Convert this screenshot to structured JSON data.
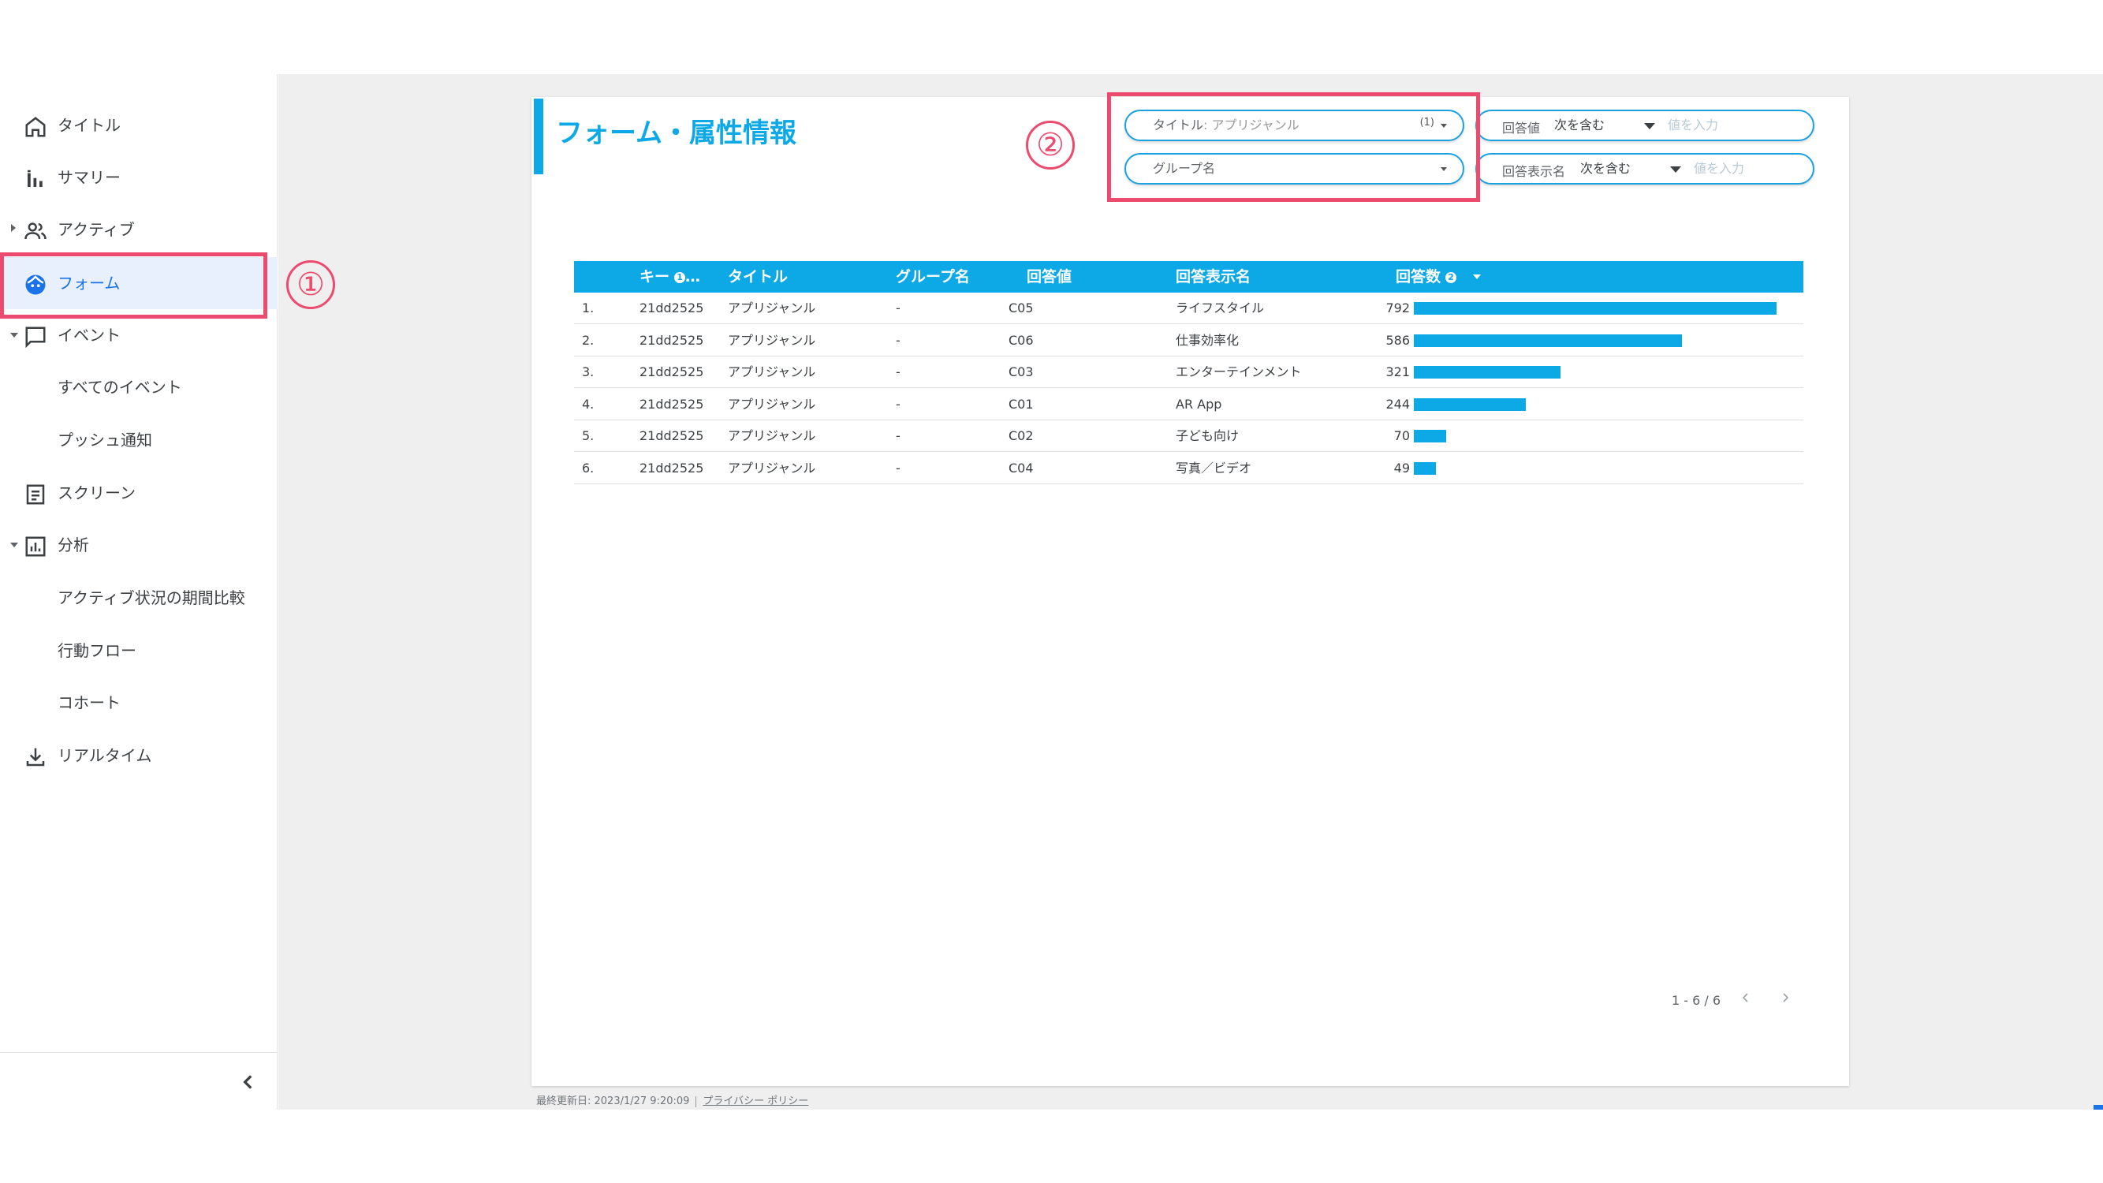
{
  "sidebar": {
    "items": [
      {
        "label": "タイトル",
        "icon": "home-icon"
      },
      {
        "label": "サマリー",
        "icon": "bar-chart-icon"
      },
      {
        "label": "アクティブ",
        "icon": "people-icon"
      },
      {
        "label": "フォーム",
        "icon": "face-icon"
      },
      {
        "label": "イベント",
        "icon": "comment-icon"
      },
      {
        "label": "すべてのイベント"
      },
      {
        "label": "プッシュ通知"
      },
      {
        "label": "スクリーン",
        "icon": "document-icon"
      },
      {
        "label": "分析",
        "icon": "analytics-icon"
      },
      {
        "label": "アクティブ状況の期間比較"
      },
      {
        "label": "行動フロー"
      },
      {
        "label": "コホート"
      },
      {
        "label": "リアルタイム",
        "icon": "download-icon"
      }
    ],
    "active_index": 3,
    "active_color": "#1a73e8"
  },
  "annotations": {
    "one": "①",
    "two": "②",
    "color": "#ec4a6e"
  },
  "report": {
    "title": "フォーム・属性情報",
    "accent": "#0da9e6",
    "filters": {
      "title_filter": {
        "label": "タイトル",
        "value": ": アプリジャンル",
        "count": "(1)"
      },
      "group_filter": {
        "label": "グループ名"
      },
      "answer_value": {
        "label": "回答値",
        "operator": "次を含む",
        "placeholder": "値を入力"
      },
      "answer_display": {
        "label": "回答表示名",
        "operator": "次を含む",
        "placeholder": "値を入力"
      }
    },
    "table": {
      "headers": {
        "key": "キー",
        "key_suffix": "…",
        "title": "タイトル",
        "group": "グループ名",
        "value": "回答値",
        "display": "回答表示名",
        "count": "回答数"
      },
      "info1": "1",
      "info2": "2",
      "rows": [
        {
          "idx": "1.",
          "key": "21dd2525",
          "title": "アプリジャンル",
          "group": "-",
          "value": "C05",
          "display": "ライフスタイル",
          "count": "792",
          "n": 792
        },
        {
          "idx": "2.",
          "key": "21dd2525",
          "title": "アプリジャンル",
          "group": "-",
          "value": "C06",
          "display": "仕事効率化",
          "count": "586",
          "n": 586
        },
        {
          "idx": "3.",
          "key": "21dd2525",
          "title": "アプリジャンル",
          "group": "-",
          "value": "C03",
          "display": "エンターテインメント",
          "count": "321",
          "n": 321
        },
        {
          "idx": "4.",
          "key": "21dd2525",
          "title": "アプリジャンル",
          "group": "-",
          "value": "C01",
          "display": "AR App",
          "count": "244",
          "n": 244
        },
        {
          "idx": "5.",
          "key": "21dd2525",
          "title": "アプリジャンル",
          "group": "-",
          "value": "C02",
          "display": "子ども向け",
          "count": "70",
          "n": 70
        },
        {
          "idx": "6.",
          "key": "21dd2525",
          "title": "アプリジャンル",
          "group": "-",
          "value": "C04",
          "display": "写真／ビデオ",
          "count": "49",
          "n": 49
        }
      ],
      "max_count": 792
    },
    "pagination": "1 - 6 / 6"
  },
  "footer": {
    "updated": "最終更新日: 2023/1/27 9:20:09",
    "privacy": "プライバシー ポリシー"
  }
}
